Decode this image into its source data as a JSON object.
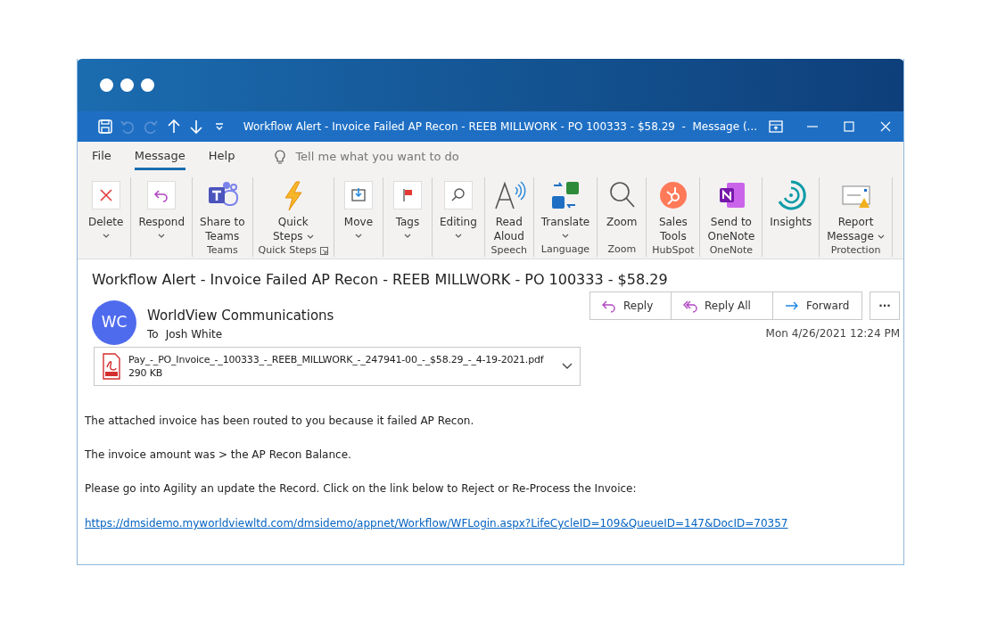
{
  "window": {
    "title": "Workflow Alert - Invoice Failed AP Recon - REEB MILLWORK - PO 100333 - $58.29  -  Message (...",
    "quick_access": [
      {
        "kind": "save",
        "disabled": false
      },
      {
        "kind": "undo",
        "disabled": true
      },
      {
        "kind": "redo",
        "disabled": true
      },
      {
        "kind": "up",
        "disabled": false
      },
      {
        "kind": "down",
        "disabled": false
      },
      {
        "kind": "customize",
        "disabled": false
      }
    ],
    "controls": [
      {
        "kind": "ribbon-options"
      },
      {
        "kind": "minimize"
      },
      {
        "kind": "maximize"
      },
      {
        "kind": "close"
      }
    ]
  },
  "menu_tabs": [
    {
      "label": "File",
      "selected": false
    },
    {
      "label": "Message",
      "selected": true
    },
    {
      "label": "Help",
      "selected": false
    }
  ],
  "tell_me": {
    "placeholder": "Tell me what you want to do"
  },
  "ribbon": [
    {
      "buttons": [
        {
          "kind": "delete",
          "lines": [
            "Delete"
          ],
          "dropdown": true
        }
      ]
    },
    {
      "buttons": [
        {
          "kind": "respond",
          "lines": [
            "Respond"
          ],
          "dropdown": true
        }
      ]
    },
    {
      "label": "Teams",
      "buttons": [
        {
          "kind": "teams",
          "lines": [
            "Share to",
            "Teams"
          ],
          "dropdown": false
        }
      ]
    },
    {
      "label": "Quick Steps",
      "launcher": true,
      "buttons": [
        {
          "kind": "quicksteps",
          "lines": [
            "Quick",
            "Steps"
          ],
          "dropdown": true
        }
      ]
    },
    {
      "buttons": [
        {
          "kind": "move",
          "lines": [
            "Move"
          ],
          "dropdown": true
        }
      ]
    },
    {
      "buttons": [
        {
          "kind": "tags",
          "lines": [
            "Tags"
          ],
          "dropdown": true
        }
      ]
    },
    {
      "buttons": [
        {
          "kind": "editing",
          "lines": [
            "Editing"
          ],
          "dropdown": true
        }
      ]
    },
    {
      "label": "Speech",
      "buttons": [
        {
          "kind": "readaloud",
          "lines": [
            "Read",
            "Aloud"
          ],
          "dropdown": false
        }
      ]
    },
    {
      "label": "Language",
      "buttons": [
        {
          "kind": "translate",
          "lines": [
            "Translate"
          ],
          "dropdown": true
        }
      ]
    },
    {
      "label": "Zoom",
      "buttons": [
        {
          "kind": "zoom",
          "lines": [
            "Zoom"
          ],
          "dropdown": false
        }
      ]
    },
    {
      "label": "HubSpot",
      "buttons": [
        {
          "kind": "hubspot",
          "lines": [
            "Sales",
            "Tools"
          ],
          "dropdown": false
        }
      ]
    },
    {
      "label": "OneNote",
      "buttons": [
        {
          "kind": "onenote",
          "lines": [
            "Send to",
            "OneNote"
          ],
          "dropdown": false
        }
      ]
    },
    {
      "buttons": [
        {
          "kind": "insights",
          "lines": [
            "Insights"
          ],
          "dropdown": false
        }
      ]
    },
    {
      "label": "Protection",
      "buttons": [
        {
          "kind": "report",
          "lines": [
            "Report",
            "Message"
          ],
          "dropdown": true
        }
      ]
    }
  ],
  "message": {
    "subject": "Workflow Alert - Invoice Failed AP Recon - REEB MILLWORK - PO 100333 - $58.29",
    "avatar": "WC",
    "sender": "WorldView Communications",
    "to_label": "To",
    "to": "Josh White",
    "actions": [
      {
        "kind": "reply",
        "label": "Reply"
      },
      {
        "kind": "replyall",
        "label": "Reply All"
      },
      {
        "kind": "forward",
        "label": "Forward"
      }
    ],
    "more": "···",
    "date": "Mon 4/26/2021 12:24 PM",
    "attachment": {
      "name": "Pay_-_PO_Invoice_-_100333_-_REEB_MILLWORK_-_247941-00_-_$58.29_-_4-19-2021.pdf",
      "size": "290 KB"
    },
    "body": [
      "The attached invoice has been routed to you because it failed AP Recon.",
      "The invoice amount was > the AP Recon Balance.",
      "Please go into Agility an update the Record. Click on the link below to Reject or Re-Process the Invoice:"
    ],
    "link": "https://dmsidemo.myworldviewltd.com/dmsidemo/appnet/Workflow/WFLogin.aspx?LifeCycleID=109&QueueID=147&DocID=70357"
  }
}
